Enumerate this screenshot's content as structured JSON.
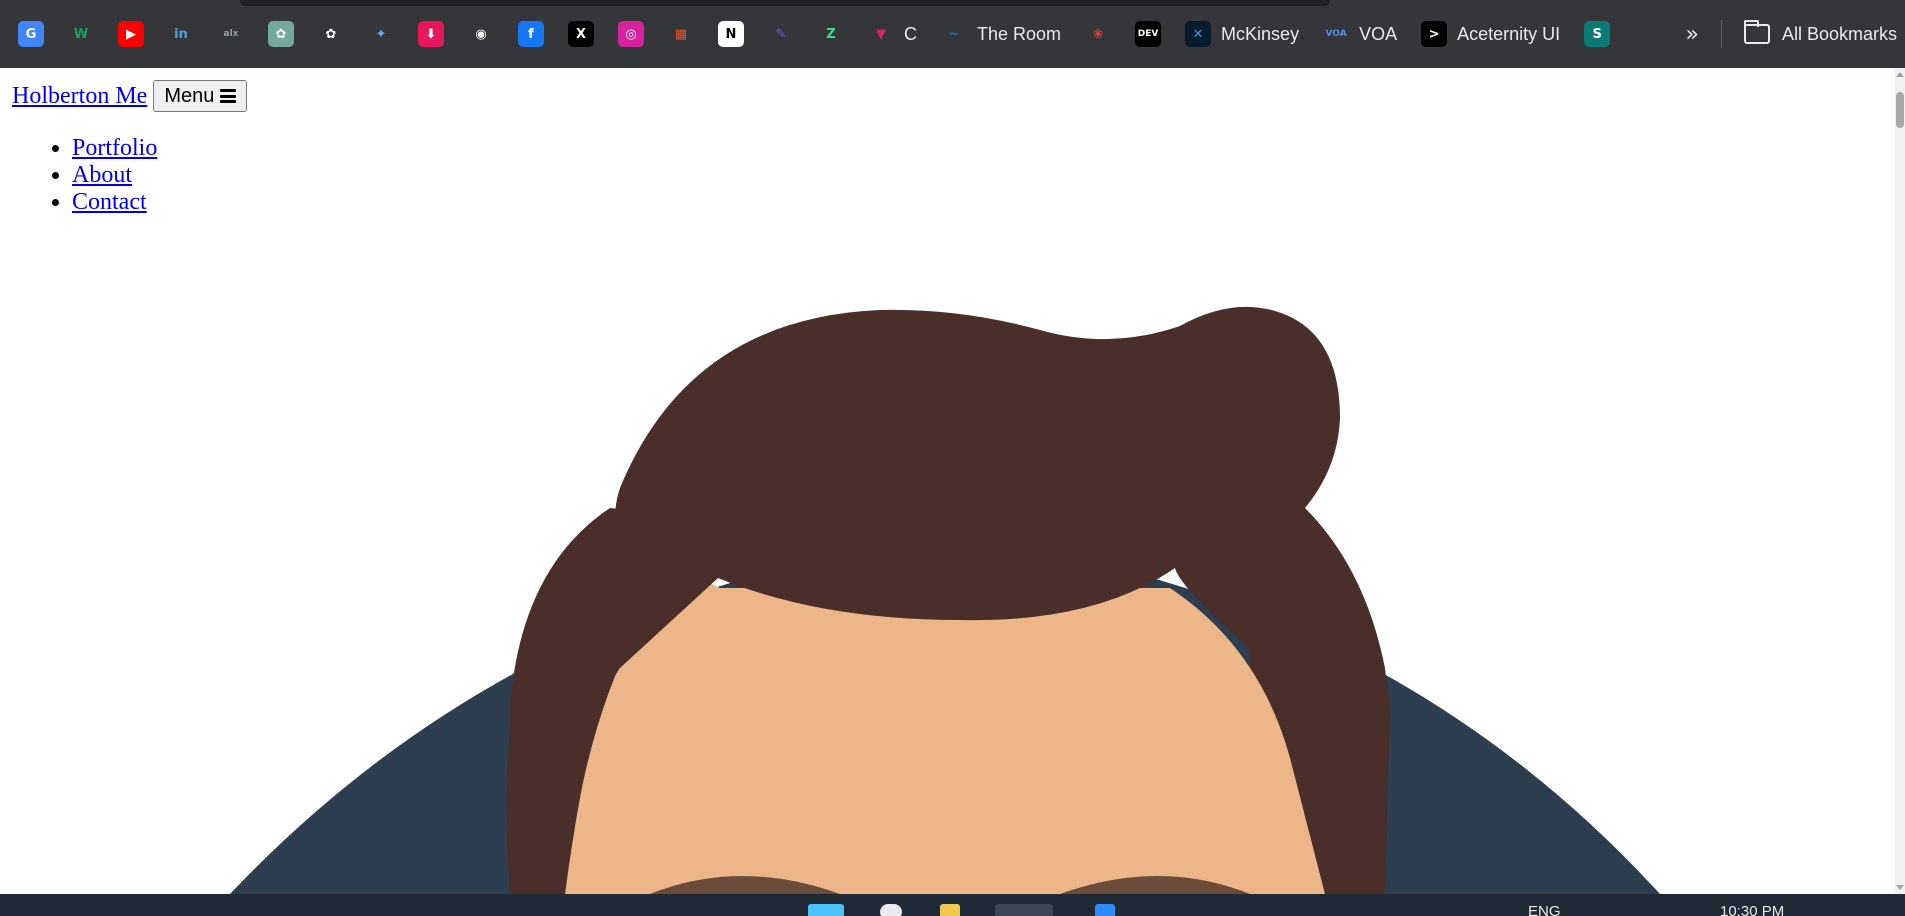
{
  "browser": {
    "bookmarks": [
      {
        "name": "google-translate",
        "glyph": "G",
        "bg": "#4285f4",
        "label": ""
      },
      {
        "name": "webflow",
        "glyph": "W",
        "bg": "#35363a",
        "fg": "#1aa260",
        "label": ""
      },
      {
        "name": "youtube",
        "glyph": "▶",
        "bg": "#ff0000",
        "label": ""
      },
      {
        "name": "linkedin",
        "glyph": "in",
        "bg": "#35363a",
        "fg": "#4fa3e0",
        "label": ""
      },
      {
        "name": "alx",
        "glyph": "alx",
        "bg": "#35363a",
        "fg": "#9aa0a6",
        "label": ""
      },
      {
        "name": "chatgpt-green",
        "glyph": "✿",
        "bg": "#74aa9c",
        "label": ""
      },
      {
        "name": "chatgpt",
        "glyph": "✿",
        "bg": "#35363a",
        "fg": "#ffffff",
        "label": ""
      },
      {
        "name": "gemini",
        "glyph": "✦",
        "bg": "#35363a",
        "fg": "#6ea8fe",
        "label": ""
      },
      {
        "name": "downloader",
        "glyph": "⬇",
        "bg": "#e8175d",
        "label": ""
      },
      {
        "name": "github",
        "glyph": "◉",
        "bg": "#35363a",
        "fg": "#ffffff",
        "label": ""
      },
      {
        "name": "facebook",
        "glyph": "f",
        "bg": "#1877f2",
        "label": ""
      },
      {
        "name": "x",
        "glyph": "X",
        "bg": "#000000",
        "label": ""
      },
      {
        "name": "instagram",
        "glyph": "◎",
        "bg": "#d6249f",
        "label": ""
      },
      {
        "name": "microsoft",
        "glyph": "▦",
        "bg": "#35363a",
        "fg": "#f25022",
        "label": ""
      },
      {
        "name": "notion",
        "glyph": "N",
        "bg": "#ffffff",
        "fg": "#000000",
        "label": ""
      },
      {
        "name": "paint",
        "glyph": "✎",
        "bg": "#35363a",
        "fg": "#7c4dff",
        "label": ""
      },
      {
        "name": "zed",
        "glyph": "Z",
        "bg": "#35363a",
        "fg": "#3ddc97",
        "label": ""
      },
      {
        "name": "c-site",
        "glyph": "▼",
        "bg": "#35363a",
        "fg": "#e0245e",
        "label": "C"
      },
      {
        "name": "the-room",
        "glyph": "~",
        "bg": "#35363a",
        "fg": "#1a73e8",
        "label": "The Room"
      },
      {
        "name": "huawei",
        "glyph": "❀",
        "bg": "#35363a",
        "fg": "#e53935",
        "label": ""
      },
      {
        "name": "dev",
        "glyph": "DEV",
        "bg": "#000000",
        "label": ""
      },
      {
        "name": "mckinsey",
        "glyph": "✕",
        "bg": "#051c2c",
        "fg": "#4f8fe8",
        "label": "McKinsey"
      },
      {
        "name": "voa",
        "glyph": "VOA",
        "bg": "#35363a",
        "fg": "#4f8fe8",
        "label": "VOA"
      },
      {
        "name": "aceternity",
        "glyph": ">",
        "bg": "#000000",
        "label": "Aceternity UI"
      },
      {
        "name": "sharepoint",
        "glyph": "S",
        "bg": "#0b7a75",
        "label": ""
      }
    ],
    "overflow_chevron": "»",
    "all_bookmarks_label": "All Bookmarks"
  },
  "site": {
    "brand": "Holberton Me",
    "menu_button": "Menu",
    "nav": [
      {
        "label": "Portfolio"
      },
      {
        "label": "About"
      },
      {
        "label": "Contact"
      }
    ]
  },
  "avatar_colors": {
    "shirt": "#2c3e50",
    "hair": "#4a2e2a",
    "skin": "#ecb689",
    "brow": "#6b4c3a"
  },
  "taskbar": {
    "language": "ENG",
    "clock": "10:30 PM"
  }
}
